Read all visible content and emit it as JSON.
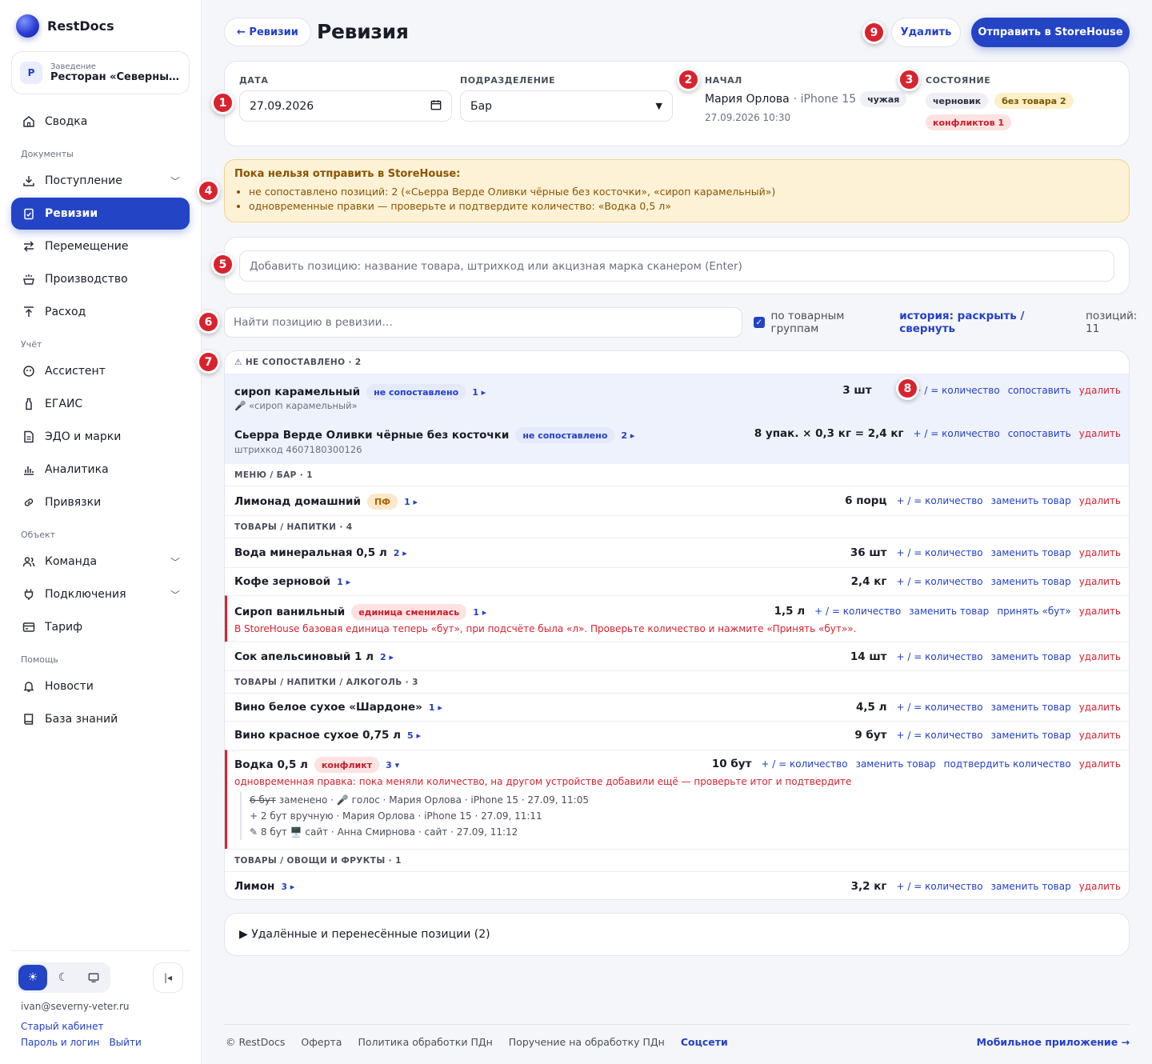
{
  "app": {
    "name": "RestDocs"
  },
  "venue": {
    "avatar": "Р",
    "caption": "Заведение",
    "name": "Ресторан «Северный …"
  },
  "nav": {
    "summary": "Сводка",
    "sec_docs": "Документы",
    "receipt": "Поступление",
    "revisions": "Ревизии",
    "transfer": "Перемещение",
    "production": "Производство",
    "expense": "Расход",
    "sec_account": "Учёт",
    "assistant": "Ассистент",
    "egais": "ЕГАИС",
    "edo": "ЭДО и марки",
    "analytics": "Аналитика",
    "bindings": "Привязки",
    "sec_object": "Объект",
    "team": "Команда",
    "connections": "Подключения",
    "tariff": "Тариф",
    "sec_help": "Помощь",
    "news": "Новости",
    "kb": "База знаний"
  },
  "user": {
    "email": "ivan@severny-veter.ru",
    "old_cabinet": "Старый кабинет",
    "password": "Пароль и логин",
    "logout": "Выйти"
  },
  "header": {
    "back": "← Ревизии",
    "title": "Ревизия",
    "delete": "Удалить",
    "send": "Отправить в StoreHouse"
  },
  "markers": [
    "1",
    "2",
    "3",
    "4",
    "5",
    "6",
    "7",
    "8",
    "9"
  ],
  "form": {
    "date_label": "ДАТА",
    "date_value": "27.09.2026",
    "dept_label": "ПОДРАЗДЕЛЕНИЕ",
    "dept_value": "Бар",
    "start_label": "НАЧАЛ",
    "start_user": "Мария Орлова",
    "start_device": "· iPhone 15",
    "start_badge": "чужая",
    "start_time": "27.09.2026 10:30",
    "state_label": "СОСТОЯНИЕ",
    "state_draft": "черновик",
    "state_nogoods": "без товара 2",
    "state_conflicts": "конфликтов 1"
  },
  "warning": {
    "title": "Пока нельзя отправить в StoreHouse:",
    "items": [
      "не сопоставлено позиций: 2 («Сьерра Верде Оливки чёрные без косточки», «сироп карамельный»)",
      "одновременные правки — проверьте и подтвердите количество: «Водка 0,5 л»"
    ]
  },
  "add": {
    "placeholder": "Добавить позицию: название товара, штрихкод или акцизная марка сканером (Enter)"
  },
  "search": {
    "placeholder": "Найти позицию в ревизии…"
  },
  "toolbar": {
    "by_groups": "по товарным группам",
    "history": "история: раскрыть / свернуть",
    "positions": "позиций: 11"
  },
  "actions": {
    "qty": "+ / = количество",
    "match": "сопоставить",
    "replace": "заменить товар",
    "delete": "удалить",
    "accept_but": "принять «бут»",
    "confirm_qty": "подтвердить количество"
  },
  "groups": {
    "unmatched": "⚠ НЕ СОПОСТАВЛЕНО · 2",
    "menu_bar": "МЕНЮ / БАР · 1",
    "drinks": "ТОВАРЫ / НАПИТКИ · 4",
    "alcohol": "ТОВАРЫ / НАПИТКИ / АЛКОГОЛЬ · 3",
    "veg": "ТОВАРЫ / ОВОЩИ И ФРУКТЫ · 1"
  },
  "rows": {
    "syrup_caramel": {
      "name": "сироп карамельный",
      "badge": "не сопоставлено",
      "count": "1 ▸",
      "sub": "🎤 «сироп карамельный»",
      "qty": "3 шт"
    },
    "olives": {
      "name": "Сьерра Верде Оливки чёрные без косточки",
      "badge": "не сопоставлено",
      "count": "2 ▸",
      "sub": "штрихкод 4607180300126",
      "qty": "8 упак. × 0,3 кг = 2,4 кг"
    },
    "lemonade": {
      "name": "Лимонад домашний",
      "badge": "ПФ",
      "count": "1 ▸",
      "qty": "6 порц"
    },
    "water": {
      "name": "Вода минеральная 0,5 л",
      "count": "2 ▸",
      "qty": "36 шт"
    },
    "coffee": {
      "name": "Кофе зерновой",
      "count": "1 ▸",
      "qty": "2,4 кг"
    },
    "vanilla": {
      "name": "Сироп ванильный",
      "badge": "единица сменилась",
      "count": "1 ▸",
      "qty": "1,5 л",
      "note": "В StoreHouse базовая единица теперь «бут», при подсчёте была «л». Проверьте количество и нажмите «Принять «бут»»."
    },
    "juice": {
      "name": "Сок апельсиновый 1 л",
      "count": "2 ▸",
      "qty": "14 шт"
    },
    "wine_white": {
      "name": "Вино белое сухое «Шардоне»",
      "count": "1 ▸",
      "qty": "4,5 л"
    },
    "wine_red": {
      "name": "Вино красное сухое 0,75 л",
      "count": "5 ▸",
      "qty": "9 бут"
    },
    "vodka": {
      "name": "Водка 0,5 л",
      "badge": "конфликт",
      "count": "3 ▾",
      "qty": "10 бут",
      "note": "одновременная правка: пока меняли количество, на другом устройстве добавили ещё — проверьте итог и подтвердите",
      "h1_old": "6 бут",
      "h1_rest": "заменено · 🎤 голос · Мария Орлова · iPhone 15 · 27.09, 11:05",
      "h2": "+ 2 бут вручную · Мария Орлова · iPhone 15 · 27.09, 11:11",
      "h3": "✎ 8 бут 🖥️ сайт · Анна Смирнова · сайт · 27.09, 11:12"
    },
    "lemon": {
      "name": "Лимон",
      "count": "3 ▸",
      "qty": "3,2 кг"
    }
  },
  "deleted": {
    "label": "▶  Удалённые и перенесённые позиции (2)"
  },
  "footer": {
    "copy": "© RestDocs",
    "offer": "Оферта",
    "privacy": "Политика обработки ПДн",
    "consent": "Поручение на обработку ПДн",
    "social": "Соцсети",
    "mobile": "Мобильное приложение →"
  }
}
